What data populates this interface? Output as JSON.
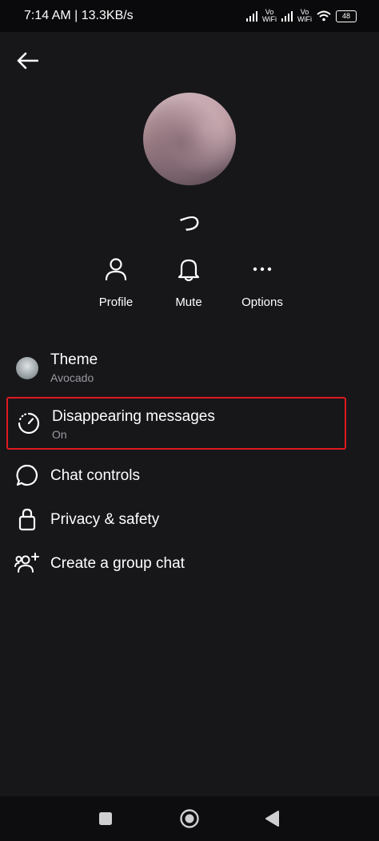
{
  "status_bar": {
    "time_speed": "7:14 AM | 13.3KB/s",
    "vo_wifi_1": [
      "Vo",
      "WiFi"
    ],
    "vo_wifi_2": [
      "Vo",
      "WiFi"
    ],
    "battery": "48"
  },
  "header": {
    "back_icon": "arrow-left-icon"
  },
  "profile": {
    "name_glyph": "つ"
  },
  "actions": [
    {
      "label": "Profile",
      "icon": "person-icon"
    },
    {
      "label": "Mute",
      "icon": "bell-icon"
    },
    {
      "label": "Options",
      "icon": "more-horizontal-icon"
    }
  ],
  "menu": {
    "theme": {
      "title": "Theme",
      "subtitle": "Avocado"
    },
    "disappearing": {
      "title": "Disappearing messages",
      "subtitle": "On"
    },
    "chat_controls": {
      "title": "Chat controls"
    },
    "privacy": {
      "title": "Privacy & safety"
    },
    "group": {
      "title": "Create a group chat"
    }
  },
  "colors": {
    "background": "#17171a",
    "highlight_border": "#e0191f",
    "subtitle": "#9a9aa0"
  }
}
